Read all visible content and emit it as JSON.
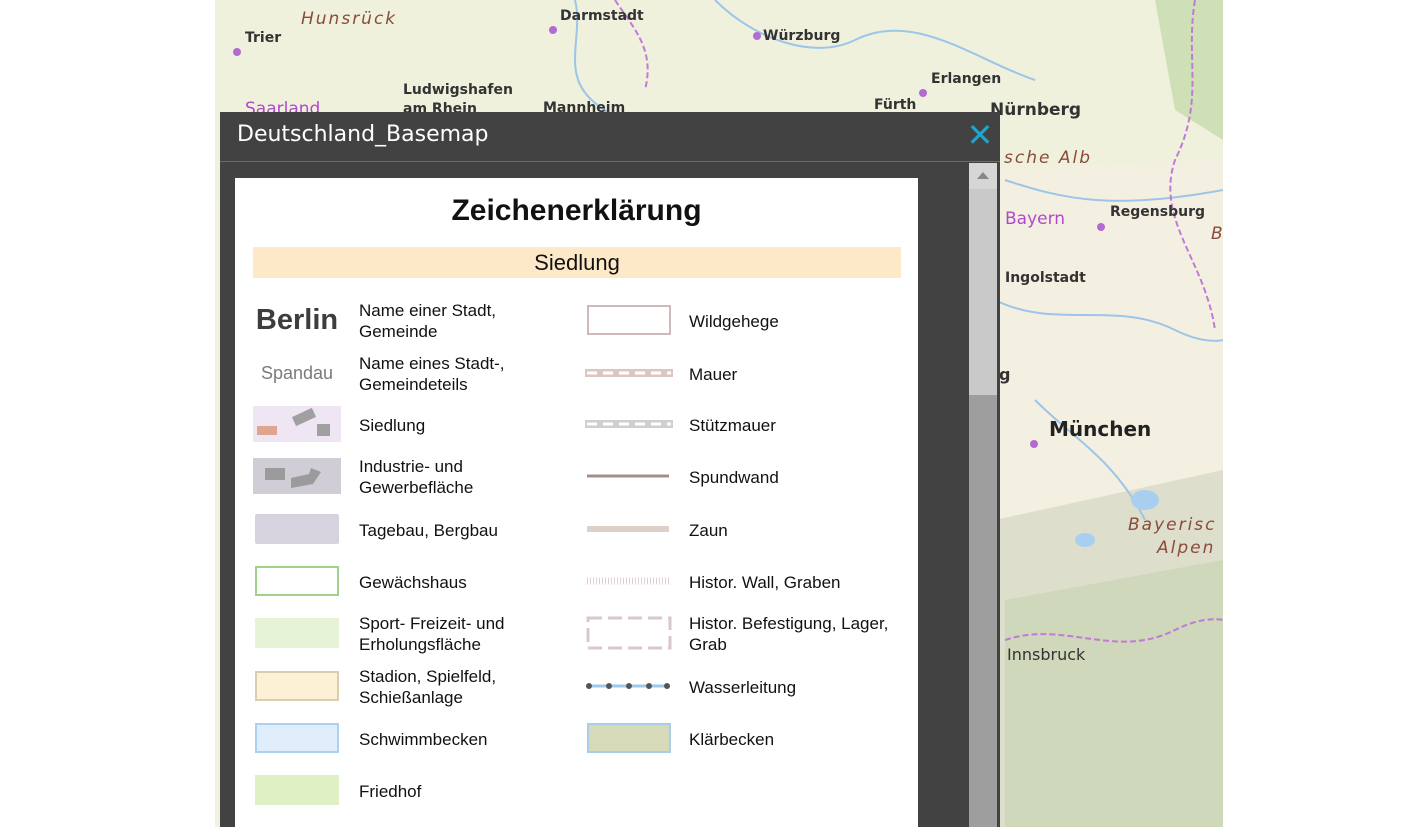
{
  "map": {
    "labels": [
      {
        "text": "Hunsrück",
        "kind": "region"
      },
      {
        "text": "Trier",
        "kind": "city"
      },
      {
        "text": "Darmstadt",
        "kind": "city"
      },
      {
        "text": "Würzburg",
        "kind": "city"
      },
      {
        "text": "Erlangen",
        "kind": "city"
      },
      {
        "text": "Ludwigshafen am Rhein",
        "kind": "city"
      },
      {
        "text": "Saarland",
        "kind": "state"
      },
      {
        "text": "Mannheim",
        "kind": "city"
      },
      {
        "text": "Fürth",
        "kind": "city"
      },
      {
        "text": "Nürnberg",
        "kind": "city"
      },
      {
        "text": "sche Alb",
        "kind": "region"
      },
      {
        "text": "Bayern",
        "kind": "state"
      },
      {
        "text": "Regensburg",
        "kind": "city"
      },
      {
        "text": "B",
        "kind": "region"
      },
      {
        "text": "Ingolstadt",
        "kind": "city"
      },
      {
        "text": "g",
        "kind": "city"
      },
      {
        "text": "München",
        "kind": "big"
      },
      {
        "text": "Bayerisc",
        "kind": "region"
      },
      {
        "text": "Alpen",
        "kind": "region"
      },
      {
        "text": "Innsbruck",
        "kind": "city"
      }
    ]
  },
  "dialog": {
    "title": "Deutschland_Basemap",
    "close_icon": "close-icon"
  },
  "legend": {
    "title": "Zeichenerklärung",
    "section": "Siedlung",
    "left": [
      {
        "symbol": "Berlin",
        "label": "Name einer Stadt, Gemeinde"
      },
      {
        "symbol": "Spandau",
        "label": "Name eines Stadt-, Gemeindeteils"
      },
      {
        "symbol": "",
        "label": "Siedlung"
      },
      {
        "symbol": "",
        "label": "Industrie- und Gewerbefläche"
      },
      {
        "symbol": "",
        "label": "Tagebau, Bergbau"
      },
      {
        "symbol": "",
        "label": "Gewächshaus"
      },
      {
        "symbol": "",
        "label": "Sport- Freizeit- und Erholungsfläche"
      },
      {
        "symbol": "",
        "label": "Stadion, Spielfeld, Schießanlage"
      },
      {
        "symbol": "",
        "label": "Schwimmbecken"
      },
      {
        "symbol": "",
        "label": "Friedhof"
      }
    ],
    "right": [
      {
        "label": "Wildgehege"
      },
      {
        "label": "Mauer"
      },
      {
        "label": "Stützmauer"
      },
      {
        "label": "Spundwand"
      },
      {
        "label": "Zaun"
      },
      {
        "label": "Histor. Wall, Graben"
      },
      {
        "label": "Histor. Befestigung, Lager, Grab"
      },
      {
        "label": "Wasserleitung"
      },
      {
        "label": "Klärbecken"
      }
    ]
  },
  "colors": {
    "dialog_bg": "#424242",
    "close": "#1ba6d0",
    "section_bar": "#fde9c8"
  }
}
